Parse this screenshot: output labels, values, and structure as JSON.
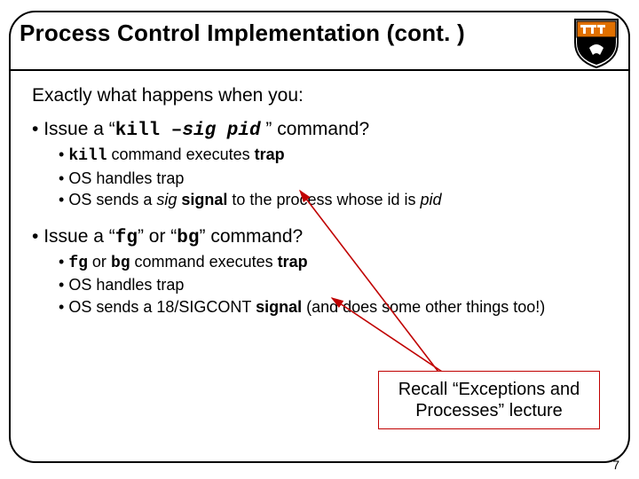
{
  "title": "Process Control Implementation (cont. )",
  "lead": "Exactly what happens when you:",
  "q1": {
    "prefix": "Issue a “",
    "cmd": "kill –",
    "arg1": "sig",
    "space": " ",
    "arg2": "pid",
    "suffix": " ” command?",
    "sub1_a": "kill",
    "sub1_b": " command executes ",
    "sub1_c": "trap",
    "sub2": "OS handles trap",
    "sub3_a": "OS sends a ",
    "sub3_b": "sig",
    "sub3_c": " ",
    "sub3_d": "signal",
    "sub3_e": " to the process whose id is ",
    "sub3_f": "pid"
  },
  "q2": {
    "prefix": "Issue a “",
    "cmd1": "fg",
    "mid": "” or “",
    "cmd2": "bg",
    "suffix": "” command?",
    "sub1_a": "fg",
    "sub1_b": " or ",
    "sub1_c": "bg",
    "sub1_d": " command executes ",
    "sub1_e": "trap",
    "sub2": "OS handles trap",
    "sub3_a": "OS sends a 18/SIGCONT ",
    "sub3_b": "signal",
    "sub3_c": " (and does some other things too!)"
  },
  "callout": "Recall “Exceptions and Processes” lecture",
  "pagenum": "7"
}
